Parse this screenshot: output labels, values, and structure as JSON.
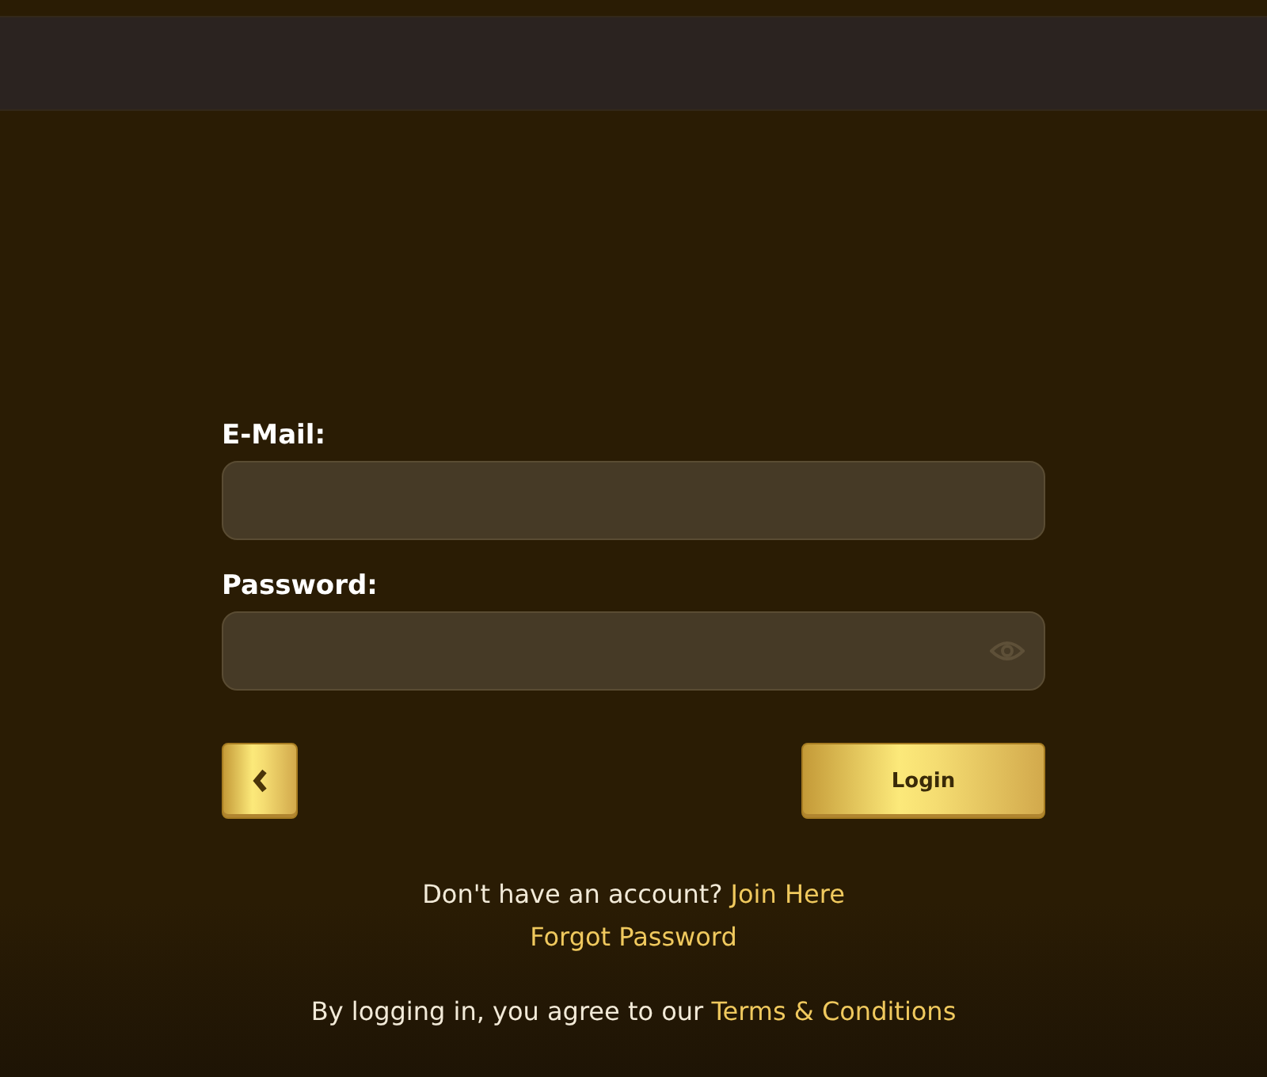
{
  "fields": [
    {
      "label": "E-Mail:",
      "kind": "text"
    },
    {
      "label": "Password:",
      "kind": "password"
    }
  ],
  "login_button": {
    "label": "Login"
  },
  "signup": {
    "text": "Don't have an account?",
    "link": "Join Here"
  },
  "forgot_link": "Forgot Password",
  "terms": {
    "text": "By logging in, you agree to our",
    "link": "Terms & Conditions"
  }
}
